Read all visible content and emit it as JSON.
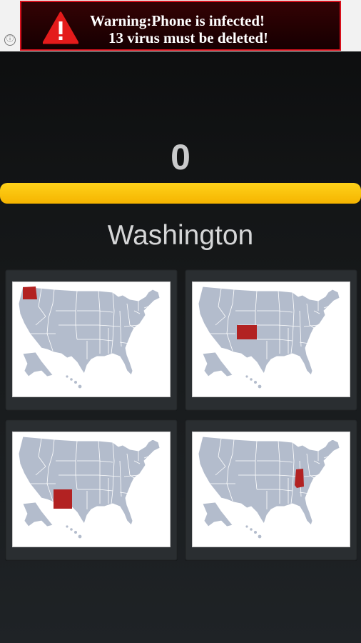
{
  "ad": {
    "info_glyph": "ⓘ",
    "line1": "Warning:Phone is infected!",
    "line2": "13 virus must be deleted!",
    "accent": "#d7101c",
    "icon": "warning-triangle-icon"
  },
  "game": {
    "score": "0",
    "progress": 1.0,
    "question": "Washington",
    "answers": [
      {
        "state": "Washington"
      },
      {
        "state": "Colorado"
      },
      {
        "state": "New Mexico"
      },
      {
        "state": "Indiana"
      }
    ],
    "highlight_color": "#b22222",
    "map_color": "#b3bccc"
  }
}
